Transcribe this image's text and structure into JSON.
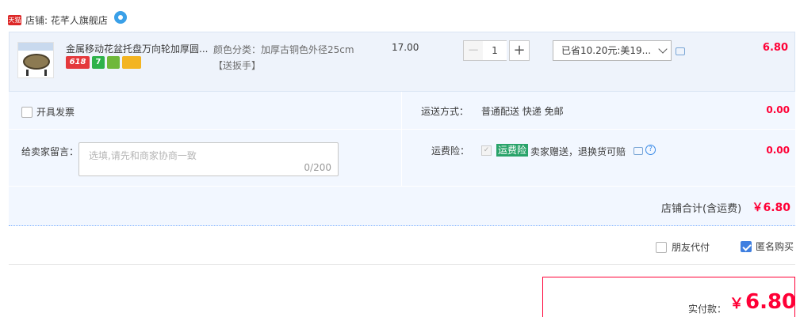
{
  "store": {
    "badge": "天猫",
    "label": "店铺: 花芊人旗舰店"
  },
  "item": {
    "title": "金属移动花盆托盘万向轮加厚圆...",
    "tags": [
      "618",
      "7",
      "",
      ""
    ],
    "sku_line1": "颜色分类：加厚古铜色外径25cm",
    "sku_line2": "【送扳手】",
    "unit_price": "17.00",
    "quantity": "1",
    "qty_minus": "−",
    "qty_plus": "+",
    "promotion": "已省10.20元:美19...",
    "subtotal": "6.80"
  },
  "options": {
    "invoice_label": "开具发票",
    "shipping_label": "运送方式：",
    "shipping_value": "普通配送 快递 免邮",
    "shipping_fee": "0.00",
    "memo_label": "给卖家留言：",
    "memo_placeholder": "选填,请先和商家协商一致",
    "memo_count": "0/200",
    "insurance_label": "运费险：",
    "insurance_badge": "运费险",
    "insurance_desc": "卖家赠送，退换货可赔",
    "insurance_fee": "0.00",
    "store_total_label": "店铺合计(含运费)",
    "store_total": "￥6.80"
  },
  "bottom": {
    "friend_pay_label": "朋友代付",
    "anonymous_label": "匿名购买",
    "anonymous_checked": true,
    "pay_label": "实付款：",
    "pay_currency": "￥",
    "pay_amount": "6.80"
  },
  "colors": {
    "price_red": "#ff0036",
    "row_bg": "#eef3fb",
    "panel_bg": "#f2f7ff",
    "checkbox_blue": "#3f7fe0",
    "insurance_green": "#29a36a"
  }
}
